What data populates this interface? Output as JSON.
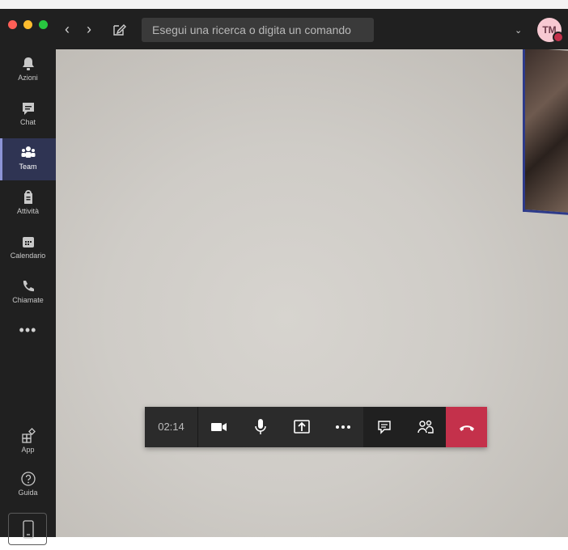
{
  "titlebar": {
    "search_placeholder": "Esegui una ricerca o digita un comando",
    "avatar_initials": "TM",
    "back_icon": "chevron-left-icon",
    "forward_icon": "chevron-right-icon",
    "compose_icon": "compose-icon",
    "dropdown_icon": "chevron-down-icon"
  },
  "sidebar": {
    "items": [
      {
        "label": "Azioni",
        "icon": "bell-icon"
      },
      {
        "label": "Chat",
        "icon": "chat-icon"
      },
      {
        "label": "Team",
        "icon": "team-icon",
        "active": true
      },
      {
        "label": "Attività",
        "icon": "assignments-icon"
      },
      {
        "label": "Calendario",
        "icon": "calendar-icon"
      },
      {
        "label": "Chiamate",
        "icon": "phone-icon"
      }
    ],
    "more_label": "•••",
    "bottom": [
      {
        "label": "App",
        "icon": "apps-icon"
      },
      {
        "label": "Guida",
        "icon": "help-icon"
      }
    ]
  },
  "callbar": {
    "timer": "02:14"
  },
  "colors": {
    "app_bg": "#202020",
    "active_item": "#2f3453",
    "hangup": "#c4314b"
  }
}
